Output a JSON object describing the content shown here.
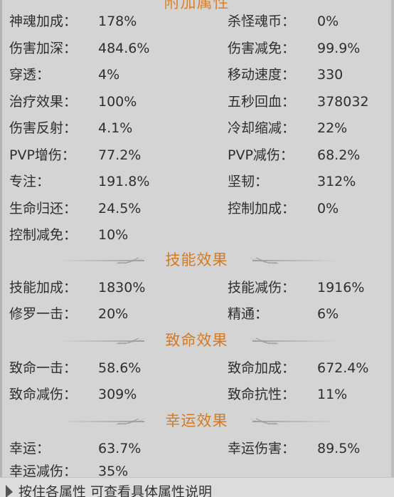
{
  "top_header": "附加属性",
  "rows_group1": [
    {
      "l1": "神魂加成：",
      "v1": "178%",
      "l2": "杀怪魂币：",
      "v2": "0%"
    },
    {
      "l1": "伤害加深：",
      "v1": "484.6%",
      "l2": "伤害减免：",
      "v2": "99.9%"
    },
    {
      "l1": "穿透：",
      "v1": "4%",
      "l2": "移动速度：",
      "v2": "330"
    },
    {
      "l1": "治疗效果：",
      "v1": "100%",
      "l2": "五秒回血：",
      "v2": "378032"
    },
    {
      "l1": "伤害反射：",
      "v1": "4.1%",
      "l2": "冷却缩减：",
      "v2": "22%"
    },
    {
      "l1": "PVP增伤：",
      "v1": "77.2%",
      "l2": "PVP减伤：",
      "v2": "68.2%"
    },
    {
      "l1": "专注：",
      "v1": "191.8%",
      "l2": "坚韧：",
      "v2": "312%"
    },
    {
      "l1": "生命归还：",
      "v1": "24.5%",
      "l2": "控制加成：",
      "v2": "0%"
    },
    {
      "l1": "控制减免：",
      "v1": "10%",
      "l2": "",
      "v2": ""
    }
  ],
  "section_skill": {
    "title": "技能效果",
    "rows": [
      {
        "l1": "技能加成：",
        "v1": "1830%",
        "l2": "技能减伤：",
        "v2": "1916%"
      },
      {
        "l1": "修罗一击：",
        "v1": "20%",
        "l2": "精通：",
        "v2": "6%"
      }
    ]
  },
  "section_crit": {
    "title": "致命效果",
    "rows": [
      {
        "l1": "致命一击：",
        "v1": "58.6%",
        "l2": "致命加成：",
        "v2": "672.4%"
      },
      {
        "l1": "致命减伤：",
        "v1": "309%",
        "l2": "致命抗性：",
        "v2": "11%"
      }
    ]
  },
  "section_luck": {
    "title": "幸运效果",
    "rows": [
      {
        "l1": "幸运：",
        "v1": "63.7%",
        "l2": "幸运伤害：",
        "v2": "89.5%"
      },
      {
        "l1": "幸运减伤：",
        "v1": "35%",
        "l2": "",
        "v2": ""
      }
    ]
  },
  "bottom_hint": "按住各属性 可查看具体属性说明",
  "colors": {
    "accent": "#d47a22",
    "panel_bg": "#d4d4d4",
    "text": "#2e2e2e"
  },
  "icons": {
    "section_wing": "swoosh-ornament-icon",
    "hint": "triangle-indicator-icon"
  }
}
